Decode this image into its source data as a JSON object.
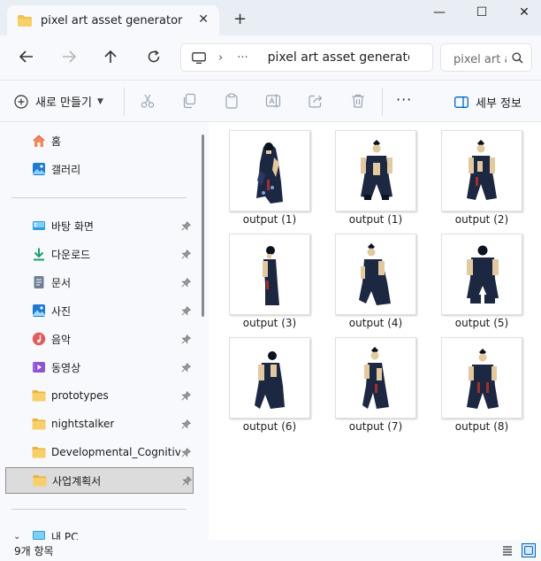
{
  "window": {
    "tab_title": "pixel art asset generator",
    "tab_close": "✕",
    "new_tab": "+",
    "minimize": "—",
    "maximize": "☐",
    "close": "✕"
  },
  "address": {
    "separator": "›",
    "ellipsis": "···",
    "path": "pixel art asset generator",
    "search_placeholder": "pixel art asset generator 검색"
  },
  "toolbar": {
    "new_label": "새로 만들기",
    "details_label": "세부 정보",
    "more": "···"
  },
  "sidebar": {
    "top_items": [
      {
        "label": "홈",
        "icon": "home-icon"
      },
      {
        "label": "갤러리",
        "icon": "gallery-icon"
      }
    ],
    "quick_access": [
      {
        "label": "바탕 화면",
        "icon": "desktop-icon",
        "pinned": true
      },
      {
        "label": "다운로드",
        "icon": "download-icon",
        "pinned": true
      },
      {
        "label": "문서",
        "icon": "document-icon",
        "pinned": true
      },
      {
        "label": "사진",
        "icon": "pictures-icon",
        "pinned": true
      },
      {
        "label": "음악",
        "icon": "music-icon",
        "pinned": true
      },
      {
        "label": "동영상",
        "icon": "video-icon",
        "pinned": true
      },
      {
        "label": "prototypes",
        "icon": "folder-icon",
        "pinned": true
      },
      {
        "label": "nightstalker",
        "icon": "folder-icon",
        "pinned": true
      },
      {
        "label": "Developmental_Cognitive_A",
        "icon": "folder-icon",
        "pinned": true
      },
      {
        "label": "사업계획서",
        "icon": "folder-icon",
        "pinned": true,
        "selected": true
      }
    ],
    "this_pc": {
      "label": "내 PC",
      "icon": "pc-icon",
      "expander": "⌄"
    }
  },
  "files": [
    {
      "name": "output (1)"
    },
    {
      "name": "output (1)"
    },
    {
      "name": "output (2)"
    },
    {
      "name": "output (3)"
    },
    {
      "name": "output (4)"
    },
    {
      "name": "output (5)"
    },
    {
      "name": "output (6)"
    },
    {
      "name": "output (7)"
    },
    {
      "name": "output (8)"
    }
  ],
  "status": {
    "item_count": "9개 항목"
  },
  "colors": {
    "accent": "#0067c0",
    "folder": "#f2c14e",
    "robe": "#1c2742",
    "skin": "#e2c9a0"
  }
}
